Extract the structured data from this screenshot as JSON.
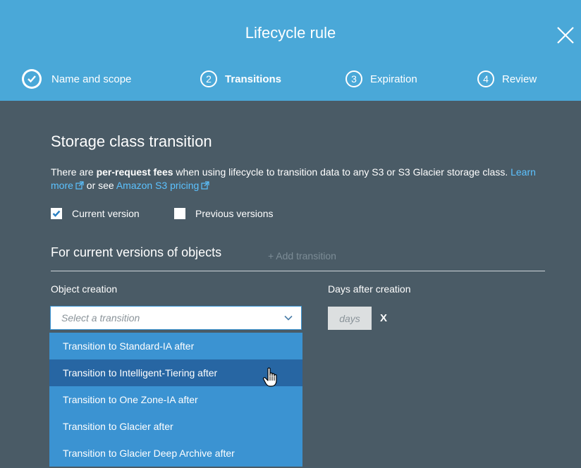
{
  "header": {
    "title": "Lifecycle rule",
    "close_icon": "close-icon",
    "steps": [
      {
        "number": "1",
        "label": "Name and scope",
        "state": "done"
      },
      {
        "number": "2",
        "label": "Transitions",
        "state": "active"
      },
      {
        "number": "3",
        "label": "Expiration",
        "state": "pending"
      },
      {
        "number": "4",
        "label": "Review",
        "state": "pending"
      }
    ]
  },
  "main": {
    "section_title": "Storage class transition",
    "desc_part1": "There are ",
    "desc_bold": "per-request fees",
    "desc_part2": " when using lifecycle to transition data to any S3 or S3 Glacier storage class. ",
    "learn_more": "Learn more",
    "desc_part3": " or see ",
    "pricing_link": "Amazon S3 pricing",
    "checkbox_current": {
      "label": "Current version",
      "checked": true
    },
    "checkbox_previous": {
      "label": "Previous versions",
      "checked": false
    },
    "subsection_title": "For current versions of objects",
    "add_transition": "+ Add transition",
    "object_creation_label": "Object creation",
    "days_label": "Days after creation",
    "select_placeholder": "Select a transition",
    "days_placeholder": "days",
    "remove_label": "X",
    "dropdown_options": [
      {
        "label": "Transition to Standard-IA after",
        "hover": false
      },
      {
        "label": "Transition to Intelligent-Tiering after",
        "hover": true
      },
      {
        "label": "Transition to One Zone-IA after",
        "hover": false
      },
      {
        "label": "Transition to Glacier after",
        "hover": false
      },
      {
        "label": "Transition to Glacier Deep Archive after",
        "hover": false
      }
    ]
  },
  "colors": {
    "header_bg": "#4aa8d8",
    "body_bg": "#4a5b66",
    "link": "#5cc2ff",
    "dropdown_bg": "#3b93d2",
    "dropdown_hover": "#2766a3"
  }
}
